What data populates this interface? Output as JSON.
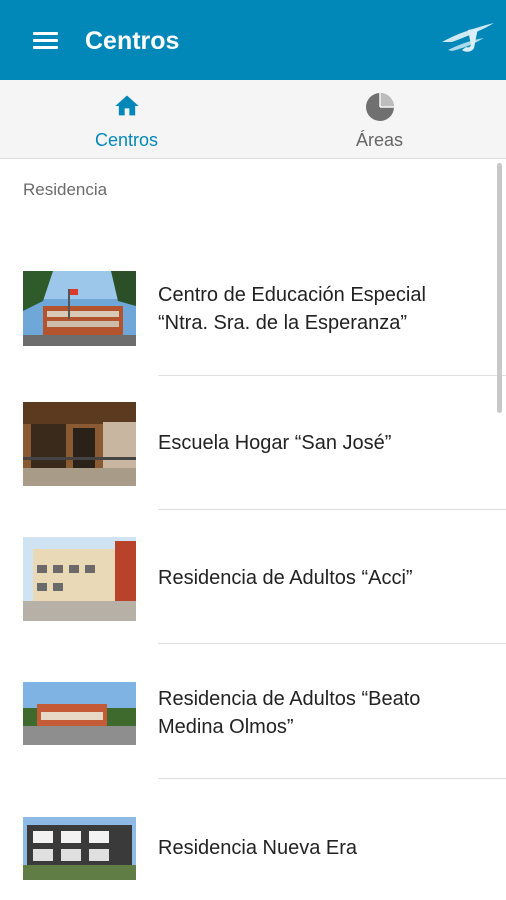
{
  "appbar": {
    "title": "Centros",
    "menu_icon": "hamburger-menu-icon",
    "logo": "brand-logo-icon"
  },
  "tabs": [
    {
      "label": "Centros",
      "icon": "home-icon",
      "active": true
    },
    {
      "label": "Áreas",
      "icon": "pie-chart-icon",
      "active": false
    }
  ],
  "section_label": "Residencia",
  "items": [
    {
      "title_line1": "Centro de Educación Especial",
      "title_line2": "“Ntra. Sra. de la Esperanza”"
    },
    {
      "title_line1": "Escuela Hogar “San José”",
      "title_line2": ""
    },
    {
      "title_line1": "Residencia de Adultos “Acci”",
      "title_line2": ""
    },
    {
      "title_line1": "Residencia de Adultos “Beato",
      "title_line2": "Medina Olmos”"
    },
    {
      "title_line1": "Residencia Nueva Era",
      "title_line2": ""
    }
  ],
  "colors": {
    "primary": "#0288b8",
    "tab_bg": "#f5f5f5",
    "divider": "#e0e0e0"
  }
}
